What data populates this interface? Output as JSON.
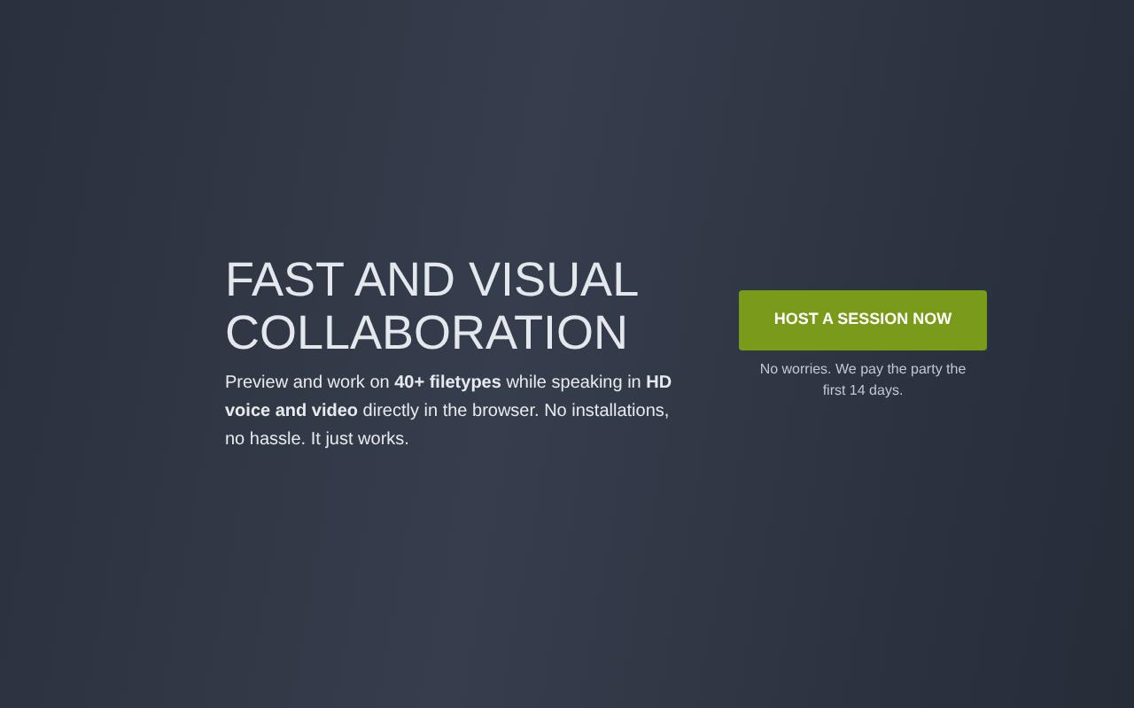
{
  "hero": {
    "title": "FAST AND VISUAL COLLABORATION",
    "description": "Preview and work on **40+ filetypes** while speaking in **HD voice and video** directly in the browser. No installations, no hassle. It just works."
  },
  "cta": {
    "button": "HOST A SESSION NOW",
    "note": "No worries. We pay the party the first 14 days."
  }
}
